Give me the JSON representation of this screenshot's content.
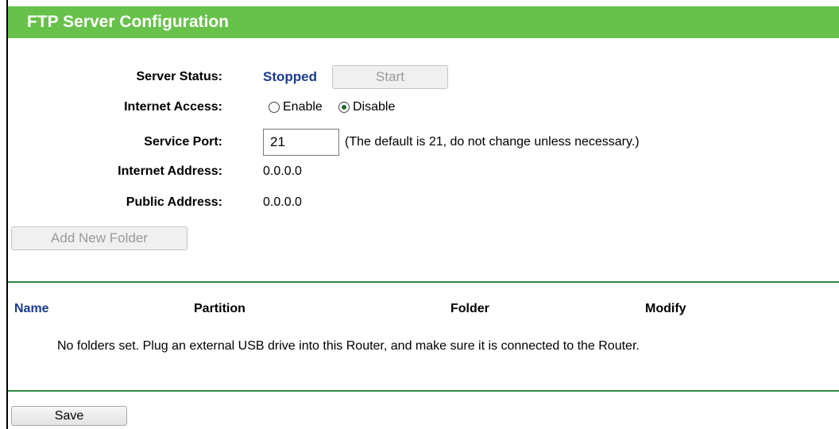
{
  "header": {
    "title": "FTP Server Configuration"
  },
  "status": {
    "server_status_label": "Server Status:",
    "server_status_value": "Stopped",
    "start_button": "Start",
    "internet_access_label": "Internet Access:",
    "enable_label": "Enable",
    "disable_label": "Disable",
    "internet_access_selected": "Disable",
    "service_port_label": "Service Port:",
    "service_port_value": "21",
    "service_port_note": "(The default is 21, do not change unless necessary.)",
    "internet_address_label": "Internet Address:",
    "internet_address_value": "0.0.0.0",
    "public_address_label": "Public Address:",
    "public_address_value": "0.0.0.0"
  },
  "folders": {
    "add_button": "Add New Folder",
    "columns": [
      "Name",
      "Partition",
      "Folder",
      "Modify"
    ],
    "empty_message": "No folders set. Plug an external USB drive into this Router, and make sure it is connected to the Router."
  },
  "footer": {
    "save_button": "Save"
  },
  "colors": {
    "header_bg": "#67c14a",
    "divider": "#2e8a3e",
    "status_text": "#1a3c8f"
  }
}
